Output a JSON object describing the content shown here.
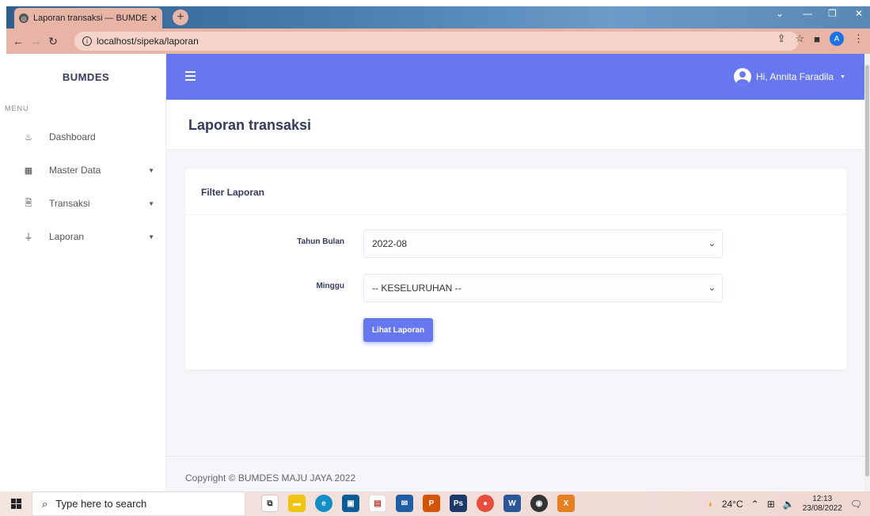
{
  "browser": {
    "tab_title": "Laporan transaksi — BUMDES M",
    "url": "localhost/sipeka/laporan",
    "profile_initial": "A"
  },
  "sidebar": {
    "brand": "BUMDES",
    "menu_header": "MENU",
    "items": [
      {
        "label": "Dashboard",
        "icon": "fire-icon"
      },
      {
        "label": "Master Data",
        "icon": "grid-icon"
      },
      {
        "label": "Transaksi",
        "icon": "file-icon"
      },
      {
        "label": "Laporan",
        "icon": "plug-icon"
      }
    ]
  },
  "topnav": {
    "user_greeting": "Hi, Annita Faradila"
  },
  "section": {
    "title": "Laporan transaksi"
  },
  "card": {
    "header": "Filter Laporan",
    "fields": [
      {
        "label": "Tahun Bulan",
        "value": "2022-08"
      },
      {
        "label": "Minggu",
        "value": "-- KESELURUHAN --"
      }
    ],
    "button": "Lihat Laporan"
  },
  "footer": {
    "copyright": "Copyright © BUMDES MAJU JAYA 2022"
  },
  "taskbar": {
    "search_placeholder": "Type here to search",
    "weather": "24°C",
    "time": "12:13",
    "date": "23/08/2022"
  },
  "colors": {
    "primary": "#6777ef",
    "sidebar_text": "#555555"
  }
}
